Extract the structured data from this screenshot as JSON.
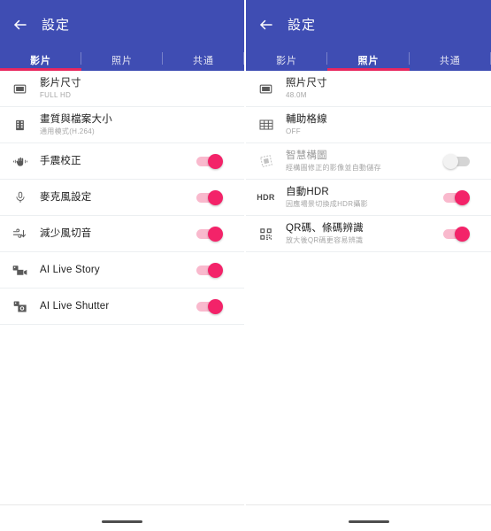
{
  "screens": [
    {
      "id": "video-settings",
      "appbar": {
        "title": "設定",
        "back_icon": "arrow-left-icon"
      },
      "tabs": [
        {
          "label": "影片",
          "active": true
        },
        {
          "label": "照片",
          "active": false
        },
        {
          "label": "共通",
          "active": false
        }
      ],
      "rows": [
        {
          "icon": "video-size-icon",
          "title": "影片尺寸",
          "subtitle": "FULL HD",
          "toggle": null
        },
        {
          "icon": "film-strip-icon",
          "title": "畫質與檔案大小",
          "subtitle": "通用模式(H.264)",
          "toggle": null
        },
        {
          "icon": "hand-shake-icon",
          "title": "手震校正",
          "subtitle": "",
          "toggle": "on"
        },
        {
          "icon": "microphone-icon",
          "title": "麥克風設定",
          "subtitle": "",
          "toggle": "on"
        },
        {
          "icon": "wind-noise-icon",
          "title": "減少風切音",
          "subtitle": "",
          "toggle": "on"
        },
        {
          "icon": "ai-live-story-icon",
          "title": "AI Live Story",
          "subtitle": "",
          "toggle": "on"
        },
        {
          "icon": "ai-live-shutter-icon",
          "title": "AI Live Shutter",
          "subtitle": "",
          "toggle": "on"
        }
      ]
    },
    {
      "id": "photo-settings",
      "appbar": {
        "title": "設定",
        "back_icon": "arrow-left-icon"
      },
      "tabs": [
        {
          "label": "影片",
          "active": false
        },
        {
          "label": "照片",
          "active": true
        },
        {
          "label": "共通",
          "active": false
        }
      ],
      "rows": [
        {
          "icon": "photo-size-icon",
          "title": "照片尺寸",
          "subtitle": "48.0M",
          "toggle": null
        },
        {
          "icon": "grid-lines-icon",
          "title": "輔助格線",
          "subtitle": "OFF",
          "toggle": null
        },
        {
          "icon": "smart-composition-icon",
          "title": "智慧構圖",
          "subtitle": "經構圖修正的影像並自動儲存",
          "toggle": "off",
          "dim": true
        },
        {
          "icon": "hdr-icon",
          "title": "自動HDR",
          "subtitle": "因應場景切換成HDR攝影",
          "toggle": "on"
        },
        {
          "icon": "qr-code-icon",
          "title": "QR碼、條碼辨識",
          "subtitle": "放大後QR碼更容易辨識",
          "toggle": "on"
        }
      ]
    }
  ],
  "colors": {
    "appbar_blue": "#3f4db3",
    "accent_pink": "#e8275f",
    "toggle_on": "#f32369",
    "toggle_track_on": "#f9b9cd",
    "toggle_off": "#d5d5d5"
  },
  "navbar": {
    "gesture_pill": "home-gesture-pill"
  }
}
